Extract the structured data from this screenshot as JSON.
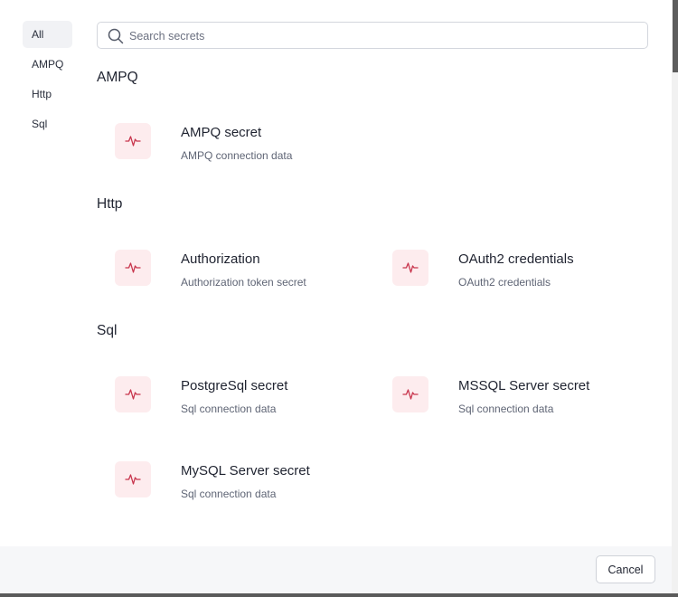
{
  "sidebar": {
    "items": [
      {
        "label": "All",
        "active": true
      },
      {
        "label": "AMPQ",
        "active": false
      },
      {
        "label": "Http",
        "active": false
      },
      {
        "label": "Sql",
        "active": false
      }
    ]
  },
  "search": {
    "placeholder": "Search secrets",
    "value": "",
    "icon": "search-icon"
  },
  "sections": [
    {
      "title": "AMPQ",
      "items": [
        {
          "title": "AMPQ secret",
          "description": "AMPQ connection data",
          "icon": "activity-icon"
        }
      ]
    },
    {
      "title": "Http",
      "items": [
        {
          "title": "Authorization",
          "description": "Authorization token secret",
          "icon": "activity-icon"
        },
        {
          "title": "OAuth2 credentials",
          "description": "OAuth2 credentials",
          "icon": "activity-icon"
        }
      ]
    },
    {
      "title": "Sql",
      "items": [
        {
          "title": "PostgreSql secret",
          "description": "Sql connection data",
          "icon": "activity-icon"
        },
        {
          "title": "MSSQL Server secret",
          "description": "Sql connection data",
          "icon": "activity-icon"
        },
        {
          "title": "MySQL Server secret",
          "description": "Sql connection data",
          "icon": "activity-icon"
        }
      ]
    }
  ],
  "footer": {
    "cancel_label": "Cancel"
  },
  "colors": {
    "icon_bg": "#fdecee",
    "icon_stroke": "#c8344c",
    "sidebar_active_bg": "#f1f2f5",
    "footer_bg": "#f6f7f9"
  }
}
